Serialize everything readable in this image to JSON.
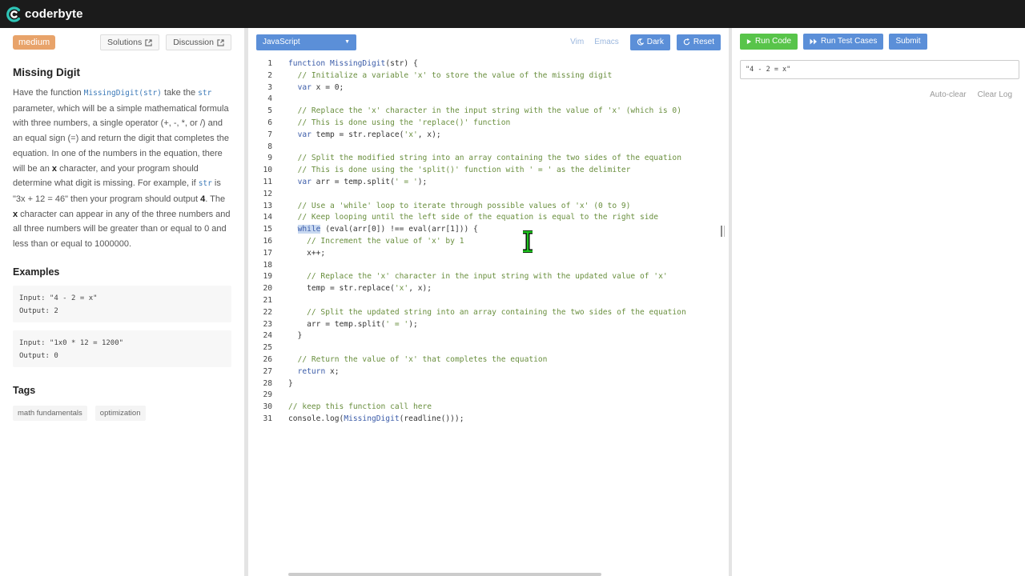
{
  "app": {
    "logo_text": "coderbyte"
  },
  "problem": {
    "difficulty": "medium",
    "solutions_label": "Solutions",
    "discussion_label": "Discussion",
    "title": "Missing Digit",
    "desc_1": "Have the function ",
    "desc_code_1": "MissingDigit(str)",
    "desc_2": " take the ",
    "desc_code_2": "str",
    "desc_3": " parameter, which will be a simple mathematical formula with three numbers, a single operator (+, -, *, or /) and an equal sign (=) and return the digit that completes the equation. In one of the numbers in the equation, there will be an ",
    "desc_bold_1": "x",
    "desc_4": " character, and your program should determine what digit is missing. For example, if ",
    "desc_code_3": "str",
    "desc_5": " is \"3x + 12 = 46\" then your program should output ",
    "desc_bold_2": "4",
    "desc_6": ". The ",
    "desc_bold_3": "x",
    "desc_7": " character can appear in any of the three numbers and all three numbers will be greater than or equal to 0 and less than or equal to 1000000.",
    "examples_title": "Examples",
    "examples": [
      {
        "input": "Input: \"4 - 2 = x\"",
        "output": "Output: 2"
      },
      {
        "input": "Input: \"1x0 * 12 = 1200\"",
        "output": "Output: 0"
      }
    ],
    "tags_title": "Tags",
    "tags": [
      "math fundamentals",
      "optimization"
    ]
  },
  "editor": {
    "language": "JavaScript",
    "vim_label": "Vim",
    "emacs_label": "Emacs",
    "dark_label": "Dark",
    "reset_label": "Reset",
    "lines": [
      "1",
      "2",
      "3",
      "4",
      "5",
      "6",
      "7",
      "8",
      "9",
      "10",
      "11",
      "12",
      "13",
      "14",
      "15",
      "16",
      "17",
      "18",
      "19",
      "20",
      "21",
      "22",
      "23",
      "24",
      "25",
      "26",
      "27",
      "28",
      "29",
      "30",
      "31"
    ],
    "code": [
      "function MissingDigit(str) {",
      "  // Initialize a variable 'x' to store the value of the missing digit",
      "  var x = 0;",
      "",
      "  // Replace the 'x' character in the input string with the value of 'x' (which is 0)",
      "  // This is done using the 'replace()' function",
      "  var temp = str.replace('x', x);",
      "",
      "  // Split the modified string into an array containing the two sides of the equation",
      "  // This is done using the 'split()' function with ' = ' as the delimiter",
      "  var arr = temp.split(' = ');",
      "",
      "  // Use a 'while' loop to iterate through possible values of 'x' (0 to 9)",
      "  // Keep looping until the left side of the equation is equal to the right side",
      "  while (eval(arr[0]) !== eval(arr[1])) {",
      "    // Increment the value of 'x' by 1",
      "    x++;",
      "",
      "    // Replace the 'x' character in the input string with the updated value of 'x'",
      "    temp = str.replace('x', x);",
      "",
      "    // Split the updated string into an array containing the two sides of the equation",
      "    arr = temp.split(' = ');",
      "  }",
      "",
      "  // Return the value of 'x' that completes the equation",
      "  return x;",
      "}",
      "",
      "// keep this function call here",
      "console.log(MissingDigit(readline()));"
    ]
  },
  "runner": {
    "run_code_label": "Run Code",
    "run_tests_label": "Run Test Cases",
    "submit_label": "Submit",
    "input_value": "\"4 - 2 = x\"",
    "auto_clear_label": "Auto-clear",
    "clear_log_label": "Clear Log"
  },
  "colors": {
    "accent_blue": "#5b8fd8",
    "run_green": "#58c44a",
    "difficulty_orange": "#e8a36a",
    "topbar": "#1b1b1b"
  }
}
